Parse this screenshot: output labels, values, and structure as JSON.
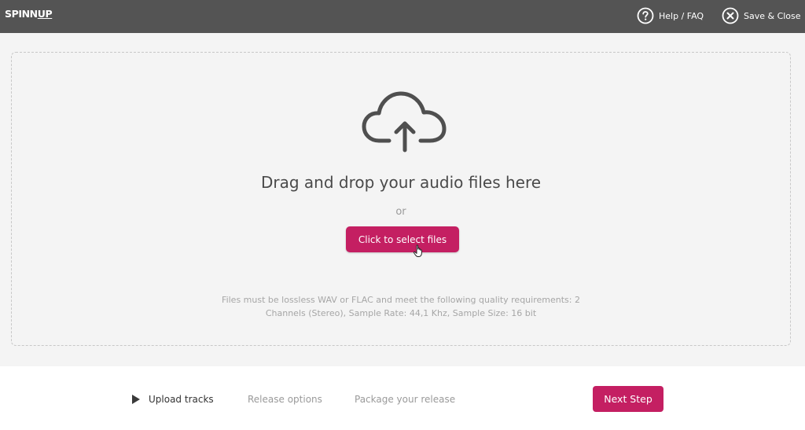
{
  "header": {
    "logo_text": "SPINN",
    "logo_text_up": "UP",
    "help_label": "Help / FAQ",
    "save_label": "Save & Close"
  },
  "dropzone": {
    "title": "Drag and drop your audio files here",
    "or_text": "or",
    "select_button": "Click to select files",
    "requirements_line1": "Files must be lossless WAV or FLAC and meet the following quality requirements: 2",
    "requirements_line2": "Channels (Stereo), Sample Rate: 44,1 Khz, Sample Size: 16 bit"
  },
  "footer": {
    "steps": [
      {
        "label": "Upload tracks",
        "active": true
      },
      {
        "label": "Release options",
        "active": false
      },
      {
        "label": "Package your release",
        "active": false
      }
    ],
    "next_button": "Next Step"
  },
  "colors": {
    "header_bg": "#545454",
    "accent": "#c41f62",
    "page_bg": "#f4f4f4"
  },
  "icons": {
    "help": "question-circle-icon",
    "close": "close-circle-icon",
    "upload": "cloud-upload-icon",
    "step": "play-triangle-icon"
  }
}
